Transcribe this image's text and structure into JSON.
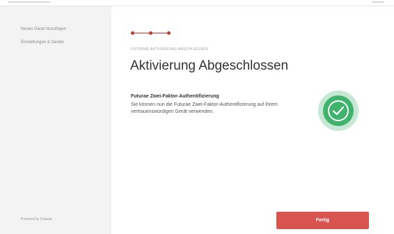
{
  "sidebar": {
    "items": [
      {
        "label": "Neues Gerät hinzufügen"
      },
      {
        "label": "Einstellungen & Geräte"
      }
    ],
    "footer": "Powered by Futurae"
  },
  "main": {
    "section_label": "FUTURAE AKTIVIERUNG ABSCHLIESSEN",
    "title": "Aktivierung Abgeschlossen",
    "card_title": "Futurae Zwei-Faktor-Authentifizierung",
    "card_body": "Sie können nun die Futurae Zwei-Faktor-Authentifizierung auf Ihrem vertrauenswürdigen Gerät verwenden.",
    "done_label": "Fertig"
  },
  "icons": {
    "success": "check-circle-icon"
  },
  "colors": {
    "accent": "#d9534f",
    "stepper": "#c0392b",
    "success": "#3fb36b",
    "sidebar_bg": "#f3f3f3"
  }
}
